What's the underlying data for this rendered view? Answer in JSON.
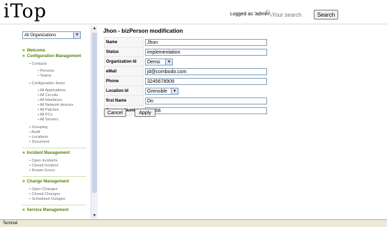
{
  "header": {
    "logo": "iTop",
    "logged_as": "Logged as 'admin'",
    "search_placeholder": "Your search",
    "search_button": "Search"
  },
  "sidebar": {
    "org_select": "All Organizations",
    "groups": [
      {
        "label": "Welcome"
      },
      {
        "label": "Configuration Management"
      }
    ],
    "config": {
      "contacts": "Contacts",
      "persons": "Persons",
      "teams": "Teams",
      "ci": "Configuration Items",
      "ci_items": [
        "All Applications",
        "All Circuits",
        "All Interfaces",
        "All Network devices",
        "All Patches",
        "All PCs",
        "All Servers"
      ],
      "other": [
        "Grouping",
        "Audit",
        "Locations",
        "Document"
      ]
    },
    "incident": {
      "label": "Incident Management",
      "items": [
        "Open Incidents",
        "Closed Incident",
        "Known Errors"
      ]
    },
    "change": {
      "label": "Change Management",
      "items": [
        "Open Changes",
        "Closed Changes",
        "Scheduled Outages"
      ]
    },
    "service": {
      "label": "Service Management"
    }
  },
  "main": {
    "title": "Jhon - bizPerson modification",
    "fields": {
      "name_label": "Name",
      "name_value": "Jhon",
      "status_label": "Status",
      "status_value": "implementation",
      "org_label": "Organization Id",
      "org_value": "Demo",
      "email_label": "eMail",
      "email_value": "jd@combodo.com",
      "phone_label": "Phone",
      "phone_value": "3245678909",
      "location_label": "Location Id",
      "location_value": "Grenoble",
      "firstname_label": "first Name",
      "firstname_value": "Do",
      "employee_label": "Employe Number",
      "employee_value": "45356"
    },
    "cancel": "Cancel",
    "apply": "Apply"
  },
  "statusbar": {
    "text": "Terminé"
  }
}
